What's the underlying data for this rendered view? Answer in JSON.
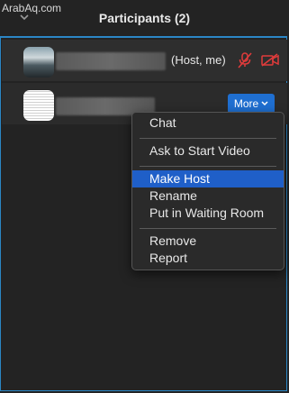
{
  "watermark": "ArabAq.com",
  "header": {
    "title": "Participants (2)"
  },
  "participants": [
    {
      "suffix": "(Host, me)",
      "mic": "mic-muted-icon",
      "video": "video-off-icon"
    },
    {
      "more_label": "More"
    }
  ],
  "context_menu": {
    "items": [
      "Chat",
      "Ask to Start Video",
      "Make Host",
      "Rename",
      "Put in Waiting Room",
      "Remove",
      "Report"
    ],
    "selected": "Make Host"
  },
  "colors": {
    "accent": "#2b86c5",
    "selected": "#1f5fc8",
    "muted_red": "#e03b3b"
  }
}
